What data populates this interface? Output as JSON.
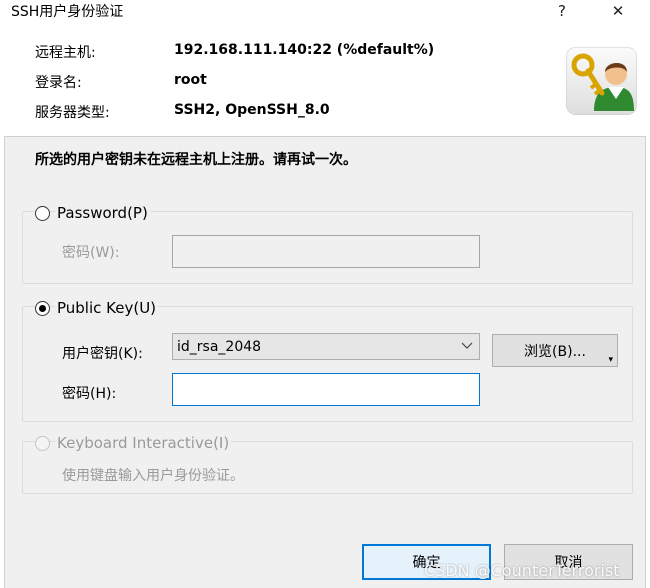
{
  "window": {
    "title": "SSH用户身份验证",
    "help_glyph": "?",
    "close_glyph": "✕"
  },
  "info": {
    "host_label": "远程主机:",
    "host_value": "192.168.111.140:22 (%default%)",
    "user_label": "登录名:",
    "user_value": "root",
    "server_label": "服务器类型:",
    "server_value": "SSH2, OpenSSH_8.0"
  },
  "message": "所选的用户密钥未在远程主机上注册。请再试一次。",
  "password_group": {
    "radio_label": "Password(P)",
    "selected": false,
    "field_label": "密码(W):",
    "field_value": ""
  },
  "pubkey_group": {
    "radio_label": "Public Key(U)",
    "selected": true,
    "key_label": "用户密钥(K):",
    "key_value": "id_rsa_2048",
    "browse_label": "浏览(B)...",
    "pass_label": "密码(H):",
    "pass_value": ""
  },
  "keyboard_group": {
    "radio_label": "Keyboard Interactive(I)",
    "selected": false,
    "description": "使用键盘输入用户身份验证。"
  },
  "buttons": {
    "ok": "确定",
    "cancel": "取消"
  },
  "watermark": "CSDN @CounterTerrorist",
  "colors": {
    "accent": "#0078d7",
    "dialog_bg": "#f0f0f0",
    "disabled_text": "#9a9a9a"
  }
}
